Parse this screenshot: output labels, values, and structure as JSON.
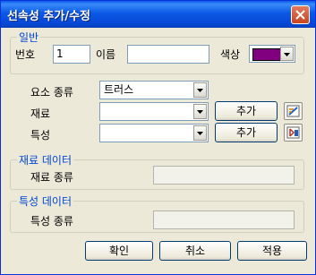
{
  "window": {
    "title": "선속성 추가/수정"
  },
  "general": {
    "legend": "일반",
    "number_label": "번호",
    "number_value": "1",
    "name_label": "이름",
    "name_value": "",
    "color_label": "색상",
    "color_value": "#800080"
  },
  "element": {
    "type_label": "요소 종류",
    "type_value": "트러스",
    "material_label": "재료",
    "material_value": "",
    "property_label": "특성",
    "property_value": "",
    "add_label": "추가",
    "material_icon": "material-icon",
    "property_icon": "property-icon"
  },
  "material_data": {
    "legend": "재료 데이터",
    "type_label": "재료 종류",
    "type_value": ""
  },
  "property_data": {
    "legend": "특성 데이터",
    "type_label": "특성 종류",
    "type_value": ""
  },
  "buttons": {
    "ok": "확인",
    "cancel": "취소",
    "apply": "적용"
  }
}
